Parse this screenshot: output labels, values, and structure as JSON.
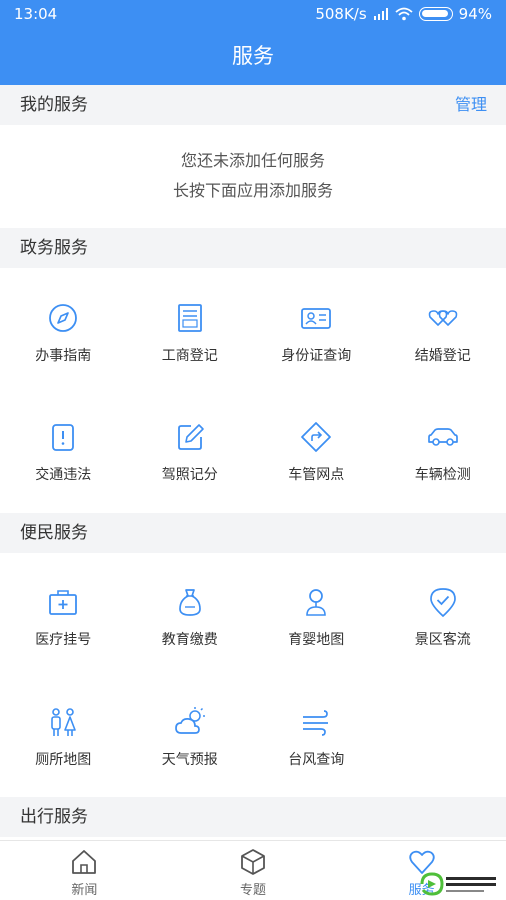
{
  "status": {
    "time": "13:04",
    "speed": "508K/s",
    "battery": "94%"
  },
  "header": {
    "title": "服务"
  },
  "my_services": {
    "title": "我的服务",
    "manage": "管理",
    "empty_line1": "您还未添加任何服务",
    "empty_line2": "长按下面应用添加服务"
  },
  "gov": {
    "title": "政务服务",
    "items": [
      {
        "label": "办事指南",
        "icon": "compass-icon"
      },
      {
        "label": "工商登记",
        "icon": "document-icon"
      },
      {
        "label": "身份证查询",
        "icon": "id-card-icon"
      },
      {
        "label": "结婚登记",
        "icon": "double-heart-icon"
      },
      {
        "label": "交通违法",
        "icon": "alert-icon"
      },
      {
        "label": "驾照记分",
        "icon": "edit-icon"
      },
      {
        "label": "车管网点",
        "icon": "direction-icon"
      },
      {
        "label": "车辆检测",
        "icon": "car-icon"
      }
    ]
  },
  "civil": {
    "title": "便民服务",
    "items": [
      {
        "label": "医疗挂号",
        "icon": "medical-kit-icon"
      },
      {
        "label": "教育缴费",
        "icon": "money-bag-icon"
      },
      {
        "label": "育婴地图",
        "icon": "baby-icon"
      },
      {
        "label": "景区客流",
        "icon": "location-check-icon"
      },
      {
        "label": "厕所地图",
        "icon": "restroom-icon"
      },
      {
        "label": "天气预报",
        "icon": "weather-icon"
      },
      {
        "label": "台风查询",
        "icon": "wind-icon"
      }
    ]
  },
  "travel": {
    "title": "出行服务"
  },
  "tabs": [
    {
      "label": "新闻",
      "icon": "home-icon"
    },
    {
      "label": "专题",
      "icon": "cube-icon"
    },
    {
      "label": "服务",
      "icon": "heart-icon"
    }
  ],
  "colors": {
    "primary": "#3d8ff3",
    "section_bg": "#f3f4f6"
  }
}
